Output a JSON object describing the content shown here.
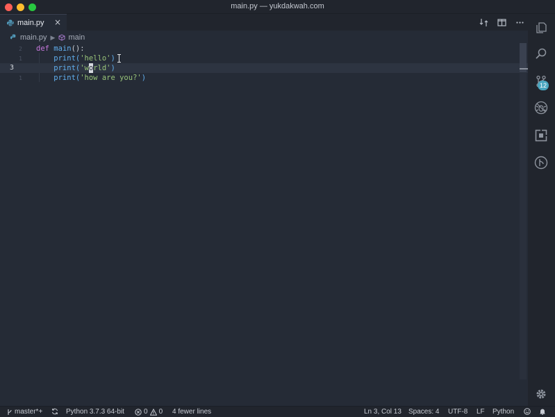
{
  "window": {
    "title": "main.py — yukdakwah.com"
  },
  "tab": {
    "label": "main.py",
    "close_glyph": "×"
  },
  "breadcrumb": {
    "file": "main.py",
    "symbol": "main"
  },
  "editor": {
    "lines": [
      {
        "number": "2",
        "tokens": [
          "def",
          " ",
          "main",
          "():"
        ]
      },
      {
        "number": "1",
        "prefix": "    print(",
        "string": "'hello'",
        "suffix": ")"
      },
      {
        "number": "3",
        "prefix": "    print(",
        "string_a": "'w",
        "cursor_char": "o",
        "string_b": "rld'",
        "suffix": ")"
      },
      {
        "number": "1",
        "prefix": "    print(",
        "string": "'how are you?'",
        "suffix": ")"
      }
    ]
  },
  "activity_bar": {
    "items": [
      "explorer-icon",
      "search-icon",
      "source-control-icon",
      "debug-icon",
      "extensions-icon",
      "git-graph-icon"
    ],
    "source_control_badge": "12",
    "settings": "gear-icon"
  },
  "status_bar": {
    "branch": "master*+",
    "interpreter": "Python 3.7.3 64-bit",
    "errors": "0",
    "warnings": "0",
    "diff_message": "4 fewer lines",
    "cursor_position": "Ln 3, Col 13",
    "indentation": "Spaces: 4",
    "encoding": "UTF-8",
    "eol": "LF",
    "language": "Python"
  },
  "colors": {
    "background": "#252b36",
    "keyword": "#c678dd",
    "function": "#61afef",
    "string": "#98c379",
    "badge": "#4aa6c0"
  }
}
